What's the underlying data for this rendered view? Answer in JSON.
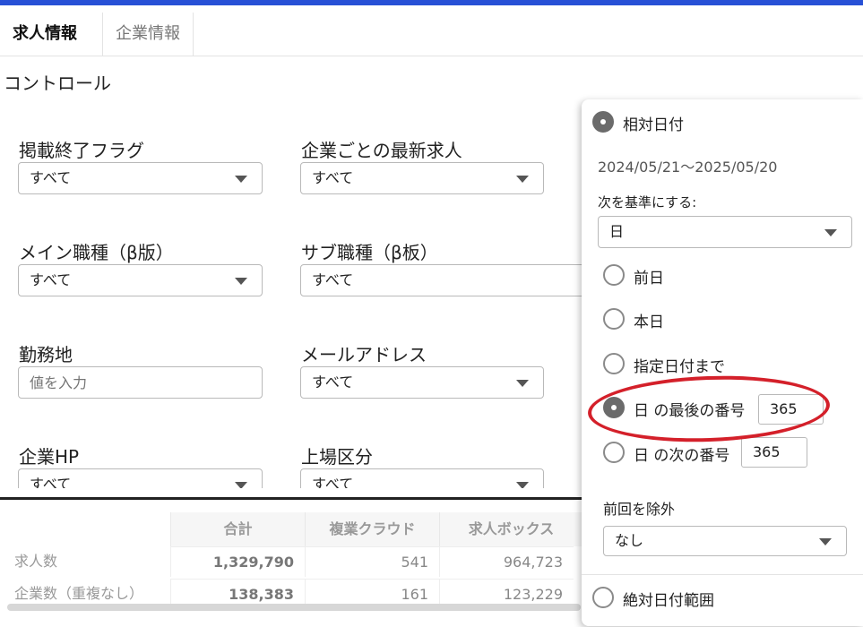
{
  "tabs": [
    "求人情報",
    "企業情報"
  ],
  "section_title": "コントロール",
  "fields": {
    "end_flag": {
      "label": "掲載終了フラグ",
      "value": "すべて"
    },
    "latest_job": {
      "label": "企業ごとの最新求人",
      "value": "すべて"
    },
    "main_job": {
      "label": "メイン職種（β版）",
      "value": "すべて"
    },
    "sub_job": {
      "label": "サブ職種（β板）",
      "value": "すべて"
    },
    "location": {
      "label": "勤務地",
      "placeholder": "値を入力"
    },
    "email": {
      "label": "メールアドレス",
      "value": "すべて"
    },
    "company_hp": {
      "label": "企業HP",
      "value": "すべて"
    },
    "listing": {
      "label": "上場区分",
      "value": "すべて"
    }
  },
  "table": {
    "headers": [
      "合計",
      "複業クラウド",
      "求人ボックス"
    ],
    "rows": [
      {
        "label": "求人数",
        "values": [
          "1,329,790",
          "541",
          "964,723"
        ]
      },
      {
        "label": "企業数（重複なし）",
        "values": [
          "138,383",
          "161",
          "123,229"
        ]
      }
    ]
  },
  "popup": {
    "relative_label": "相対日付",
    "date_range": "2024/05/21〜2025/05/20",
    "basis_label": "次を基準にする:",
    "basis_value": "日",
    "options": [
      "前日",
      "本日",
      "指定日付まで",
      "日 の最後の番号",
      "日 の次の番号"
    ],
    "last_n_value": "365",
    "next_n_value": "365",
    "exclude_label": "前回を除外",
    "exclude_value": "なし",
    "absolute_label": "絶対日付範囲"
  },
  "colors": {
    "accent": "#2750d6",
    "highlight": "#d4202a"
  }
}
